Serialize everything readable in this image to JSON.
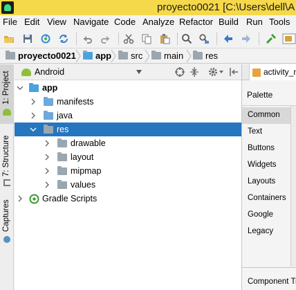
{
  "window": {
    "title": "proyecto0021 [C:\\Users\\dell\\A"
  },
  "menu": [
    "File",
    "Edit",
    "View",
    "Navigate",
    "Code",
    "Analyze",
    "Refactor",
    "Build",
    "Run",
    "Tools"
  ],
  "breadcrumb": [
    "proyecto0021",
    "app",
    "src",
    "main",
    "res"
  ],
  "left_strip": {
    "project_tab": "1: Project",
    "structure_tab": "7: Structure",
    "captures_tab": "Captures"
  },
  "project_panel": {
    "view_mode": "Android"
  },
  "tree": {
    "app": "app",
    "manifests": "manifests",
    "java": "java",
    "res": "res",
    "drawable": "drawable",
    "layout": "layout",
    "mipmap": "mipmap",
    "values": "values",
    "gradle": "Gradle Scripts"
  },
  "editor": {
    "tab_label": "activity_m"
  },
  "palette": {
    "title": "Palette",
    "categories": [
      "Common",
      "Text",
      "Buttons",
      "Widgets",
      "Layouts",
      "Containers",
      "Google",
      "Legacy"
    ],
    "component_tree": "Component Tr"
  },
  "colors": {
    "title_bar": "#f5d94a",
    "selection": "#2675bf",
    "folder": "#6fa8dc",
    "android_green": "#8fbf3a"
  }
}
